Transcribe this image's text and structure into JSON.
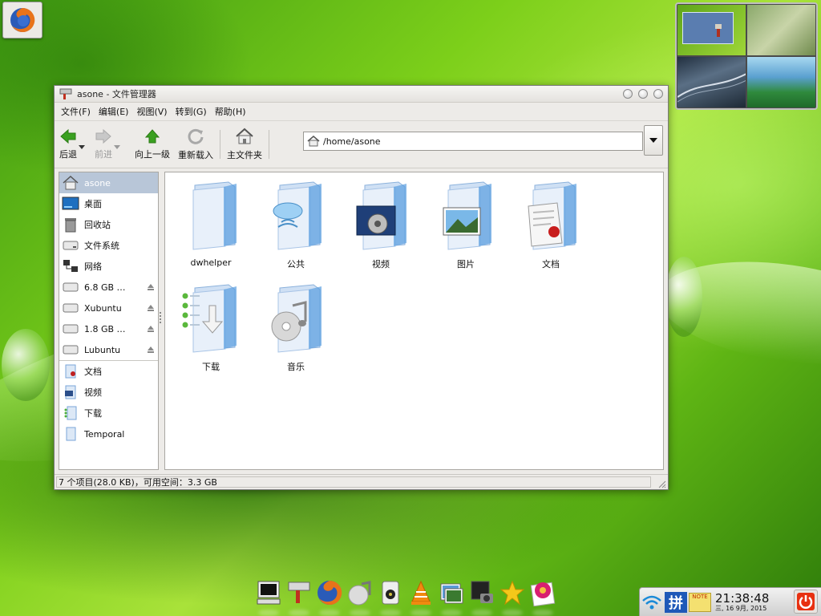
{
  "window": {
    "title": "asone - 文件管理器",
    "menu": [
      "文件(F)",
      "编辑(E)",
      "视图(V)",
      "转到(G)",
      "帮助(H)"
    ],
    "toolbar": {
      "back": "后退",
      "forward": "前进",
      "up": "向上一级",
      "reload": "重新载入",
      "home": "主文件夹"
    },
    "location": "/home/asone",
    "sidebar": {
      "items": [
        {
          "label": "asone",
          "icon": "home-icon"
        },
        {
          "label": "桌面",
          "icon": "desktop-icon"
        },
        {
          "label": "回收站",
          "icon": "trash-icon"
        },
        {
          "label": "文件系统",
          "icon": "drive-icon"
        },
        {
          "label": "网络",
          "icon": "network-icon"
        },
        {
          "label": "6.8 GB …",
          "icon": "drive-icon",
          "eject": true
        },
        {
          "label": "Xubuntu",
          "icon": "drive-icon",
          "eject": true
        },
        {
          "label": "1.8 GB …",
          "icon": "drive-icon",
          "eject": true
        },
        {
          "label": "Lubuntu",
          "icon": "drive-icon",
          "eject": true
        }
      ],
      "bookmarks": [
        {
          "label": "文档",
          "icon": "documents-folder-icon"
        },
        {
          "label": "视频",
          "icon": "videos-folder-icon"
        },
        {
          "label": "下载",
          "icon": "downloads-folder-icon"
        },
        {
          "label": "Temporal",
          "icon": "folder-icon"
        }
      ]
    },
    "folders": [
      {
        "label": "dwhelper",
        "icon": "folder-icon"
      },
      {
        "label": "公共",
        "icon": "public-folder-icon"
      },
      {
        "label": "视频",
        "icon": "videos-folder-icon"
      },
      {
        "label": "图片",
        "icon": "pictures-folder-icon"
      },
      {
        "label": "文档",
        "icon": "documents-folder-icon"
      },
      {
        "label": "下载",
        "icon": "downloads-folder-icon"
      },
      {
        "label": "音乐",
        "icon": "music-folder-icon"
      }
    ],
    "status": "7 个项目(28.0 KB)，可用空间：3.3 GB"
  },
  "dock": [
    "terminal-icon",
    "file-manager-icon",
    "firefox-icon",
    "music-player-icon",
    "speaker-icon",
    "vlc-icon",
    "image-viewer-icon",
    "screenshot-icon",
    "star-icon",
    "flower-icon"
  ],
  "tray": {
    "input_method": "拼",
    "note": "NOTE",
    "time": "21:38:48",
    "date": "三, 16  9月, 2015"
  }
}
